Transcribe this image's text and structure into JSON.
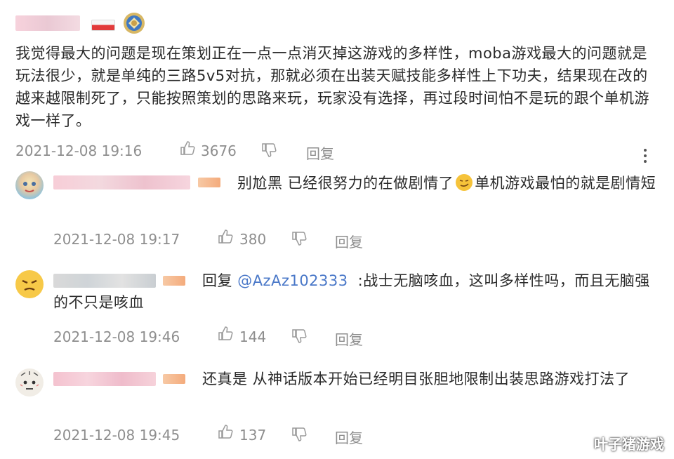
{
  "main_comment": {
    "text": "我觉得最大的问题是现在策划正在一点一点消灭掉这游戏的多样性，moba游戏最大的问题就是玩法很少，就是单纯的三路5v5对抗，那就必须在出装天赋技能多样性上下功夫，结果现在改的越来越限制死了，只能按照策划的思路来玩，玩家没有选择，再过段时间怕不是玩的跟个单机游戏一样了。",
    "date": "2021-12-08 19:16",
    "likes": "3676",
    "reply_label": "回复"
  },
  "replies": [
    {
      "text_a": "别尬黑  已经很努力的在做剧情了",
      "text_b": "单机游戏最怕的就是剧情短",
      "date": "2021-12-08 19:17",
      "likes": "380",
      "reply_label": "回复"
    },
    {
      "prefix": "回复 ",
      "mention": "@AzAz102333",
      "text": ":战士无脑咳血，这叫多样性吗，而且无脑强的不只是咳血",
      "date": "2021-12-08 19:46",
      "likes": "144",
      "reply_label": "回复"
    },
    {
      "text": "还真是 从神话版本开始已经明目张胆地限制出装思路游戏打法了",
      "date": "2021-12-08 19:45",
      "likes": "137",
      "reply_label": "回复"
    }
  ],
  "watermark": "叶子猪游戏",
  "icons": {
    "like": "thumbs-up-icon",
    "dislike": "thumbs-down-icon",
    "more": "more-vertical-icon",
    "emoji": "smirk-emoji-icon"
  }
}
